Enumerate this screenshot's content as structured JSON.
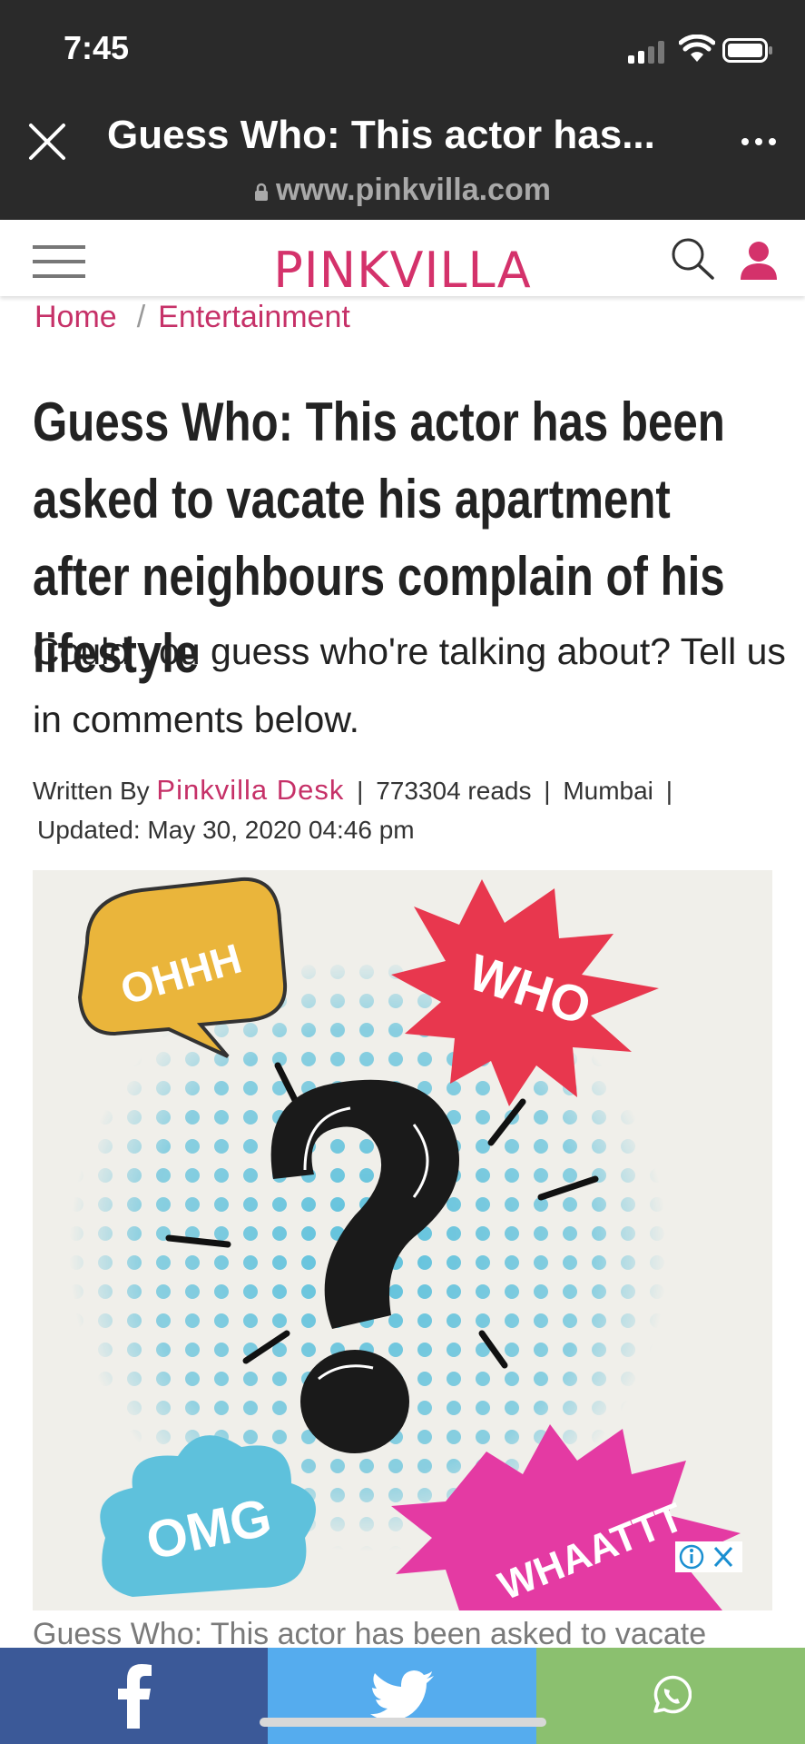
{
  "status_bar": {
    "time": "7:45"
  },
  "browser": {
    "page_title": "Guess Who: This actor has...",
    "url": "www.pinkvilla.com"
  },
  "site": {
    "brand": "PINKVILLA"
  },
  "breadcrumb": {
    "home": "Home",
    "separator": "/",
    "section": "Entertainment"
  },
  "article": {
    "headline": "Guess Who: This actor has been asked to vacate his apartment after neighbours complain of his lifestyle",
    "subhead": "Could you guess who're talking about? Tell us in comments below.",
    "byline": {
      "written_by_label": "Written By",
      "author": "Pinkvilla Desk",
      "reads": "773304 reads",
      "location": "Mumbai",
      "updated": "Updated: May 30, 2020 04:46 pm"
    },
    "image_words": {
      "ohhh": "OHHH",
      "who": "WHO",
      "omg": "OMG",
      "whaattt": "WHAATTT"
    },
    "caption": "Guess Who: This actor has been asked to vacate"
  },
  "share": {
    "facebook_icon": "facebook-icon",
    "twitter_icon": "twitter-icon",
    "whatsapp_icon": "whatsapp-icon",
    "colors": {
      "facebook": "#3b5998",
      "twitter": "#55acee",
      "whatsapp": "#8bc06f"
    }
  },
  "colors": {
    "brand": "#d4326b",
    "chrome": "#2a2a2a",
    "link": "#c63168"
  }
}
